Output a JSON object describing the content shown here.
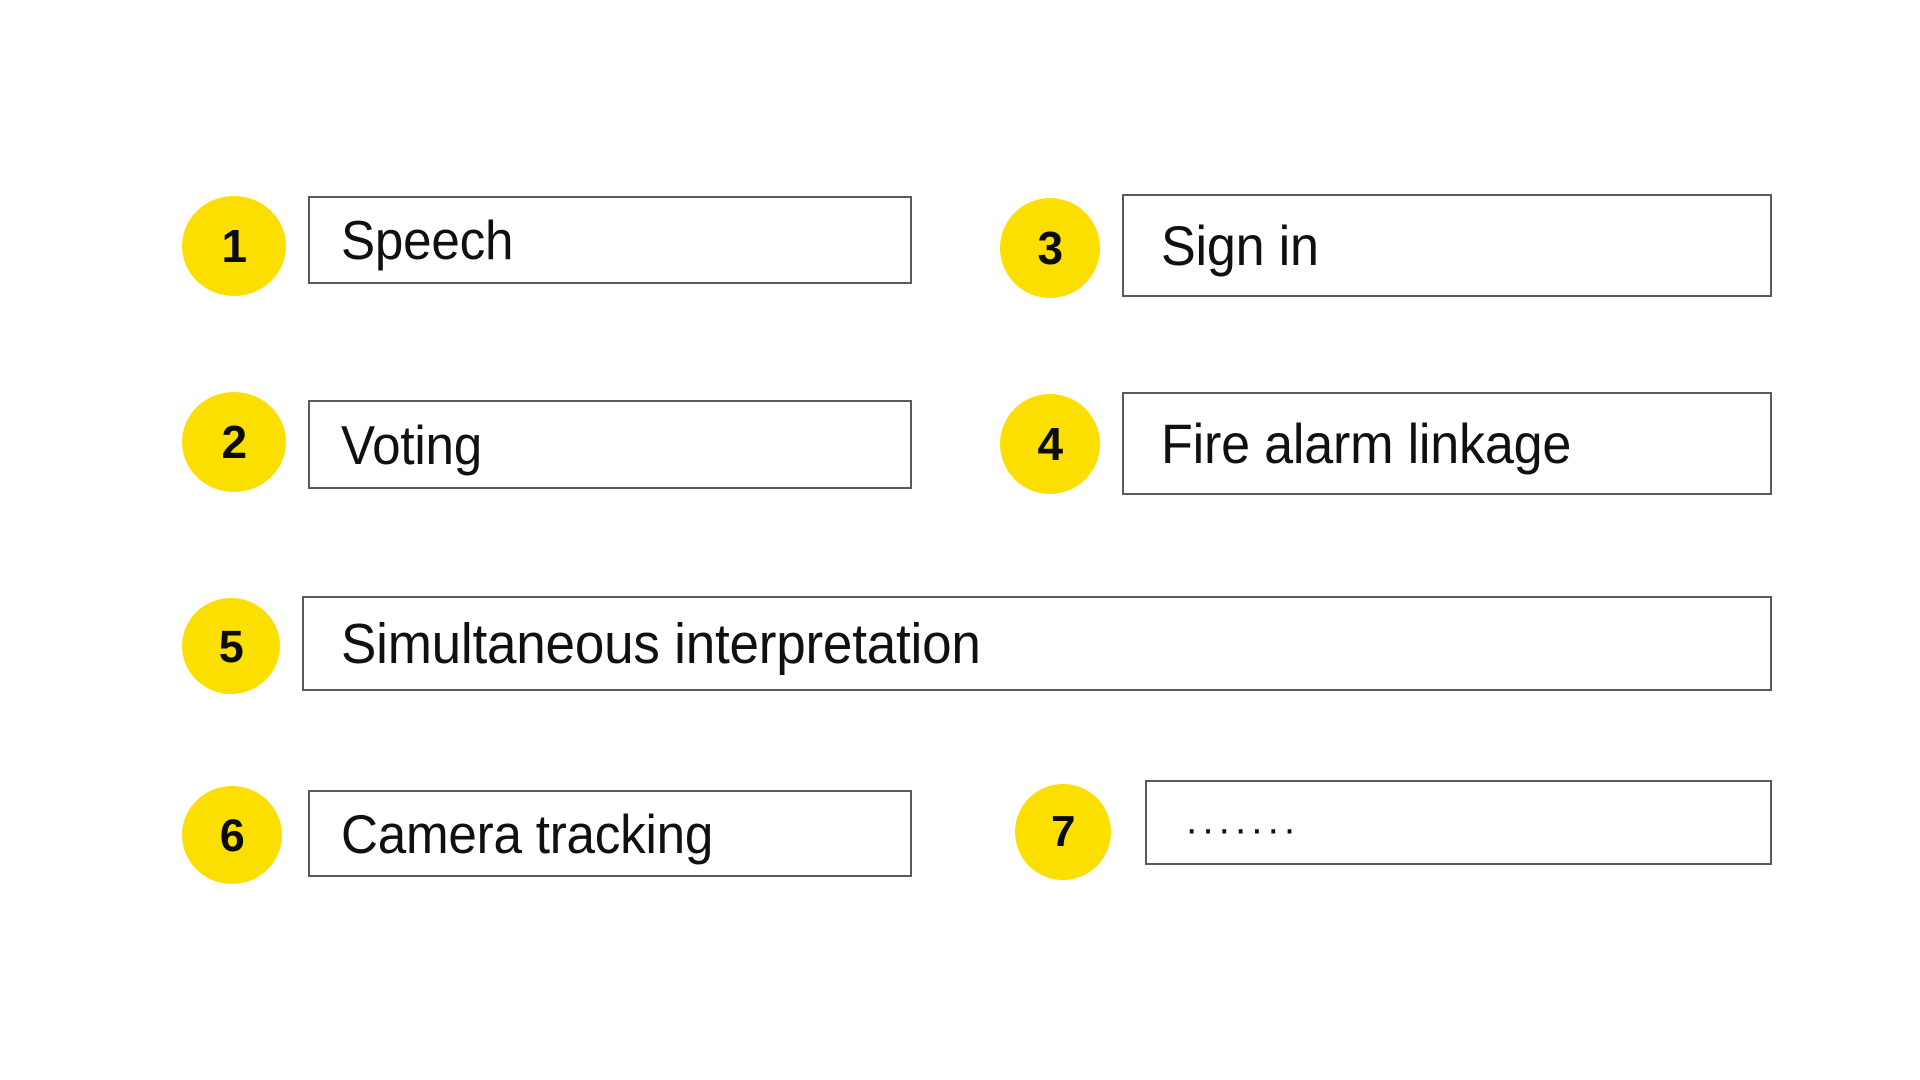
{
  "page": {
    "background_color": "#ffffff",
    "accent_color": "#fadf00",
    "text_color": "#101010",
    "border_color": "#5a5a5a"
  },
  "items": [
    {
      "number": "1",
      "label": "Speech"
    },
    {
      "number": "2",
      "label": "Voting"
    },
    {
      "number": "3",
      "label": "Sign in"
    },
    {
      "number": "4",
      "label": "Fire alarm linkage"
    },
    {
      "number": "5",
      "label": "Simultaneous interpretation"
    },
    {
      "number": "6",
      "label": "Camera tracking"
    },
    {
      "number": "7",
      "label": "·······"
    }
  ]
}
